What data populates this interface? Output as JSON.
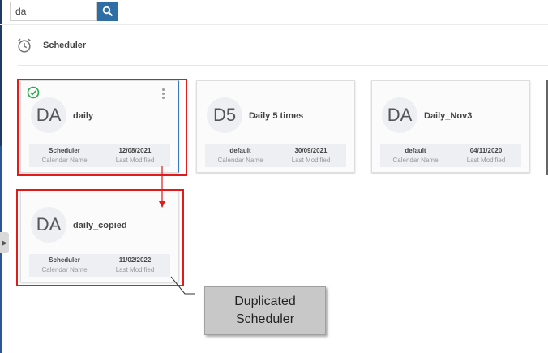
{
  "search": {
    "value": "da",
    "placeholder": ""
  },
  "header": {
    "title": "Scheduler"
  },
  "cards": [
    {
      "initials": "DA",
      "name": "daily",
      "calendar": "Scheduler",
      "modified": "12/08/2021"
    },
    {
      "initials": "D5",
      "name": "Daily 5 times",
      "calendar": "default",
      "modified": "30/09/2021"
    },
    {
      "initials": "DA",
      "name": "Daily_Nov3",
      "calendar": "default",
      "modified": "04/11/2020"
    },
    {
      "initials": "DA",
      "name": "daily_copied",
      "calendar": "Scheduler",
      "modified": "11/02/2022"
    }
  ],
  "labels": {
    "calendar_name": "Calendar Name",
    "last_modified": "Last Modified"
  },
  "annotation": {
    "line1": "Duplicated",
    "line2": "Scheduler"
  },
  "colors": {
    "highlight": "#e01b1b",
    "search_button": "#2f6ea5",
    "active_check": "#2aa84a"
  }
}
